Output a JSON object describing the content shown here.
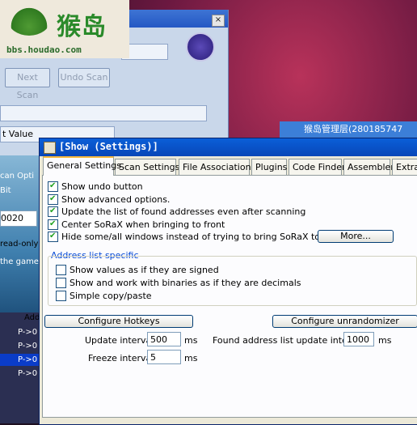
{
  "logo": {
    "name": "猴岛",
    "url": "bbs.houdao.com"
  },
  "ce_main": {
    "close_glyph": "×",
    "next_scan": "Next Scan",
    "undo_scan": "Undo Scan",
    "value_type": "t Value",
    "field_value": "0020",
    "scan_options": "can Opti",
    "bit_label": "Bit",
    "read_only": "read-only",
    "the_game": "the game",
    "addr_header": "Add",
    "rows": [
      "P->0",
      "P->0",
      "P->0",
      "P->0"
    ]
  },
  "chat": {
    "title": "猴岛管理层(280185747"
  },
  "dialog": {
    "title": "[Show (Settings)]",
    "tabs": [
      "General Settings",
      "Scan Settings",
      "File Associations",
      "Plugins",
      "Code Finder",
      "Assembler",
      "Extra"
    ],
    "general": {
      "show_undo": "Show undo button",
      "show_advanced": "Show advanced options.",
      "update_list": "Update the list of found addresses even after scanning",
      "center_sorax": "Center SoRaX when bringing to front",
      "hide_windows": "Hide some/all windows instead of trying to bring SoRaX to front",
      "more_button": "More...",
      "address_list_group": "Address list specific",
      "show_signed": "Show values as if they are signed",
      "show_binaries": "Show and work with binaries as if they are decimals",
      "simple_copy": "Simple copy/paste",
      "configure_hotkeys": "Configure Hotkeys",
      "configure_unrandomizer": "Configure unrandomizer",
      "update_interval_label": "Update interval",
      "update_interval_value": "500",
      "update_interval_unit": "ms",
      "freeze_interval_label": "Freeze interval",
      "freeze_interval_value": "5",
      "freeze_interval_unit": "ms",
      "found_list_label": "Found address list update interval",
      "found_list_value": "1000",
      "found_list_unit": "ms"
    },
    "checked": {
      "show_undo": true,
      "show_advanced": true,
      "update_list": true,
      "center_sorax": true,
      "hide_windows": true,
      "show_signed": false,
      "show_binaries": false,
      "simple_copy": false
    }
  },
  "colors": {
    "accent": "#0a5fd8",
    "tab_highlight": "#f7b93e",
    "group_title": "#0046d5"
  }
}
